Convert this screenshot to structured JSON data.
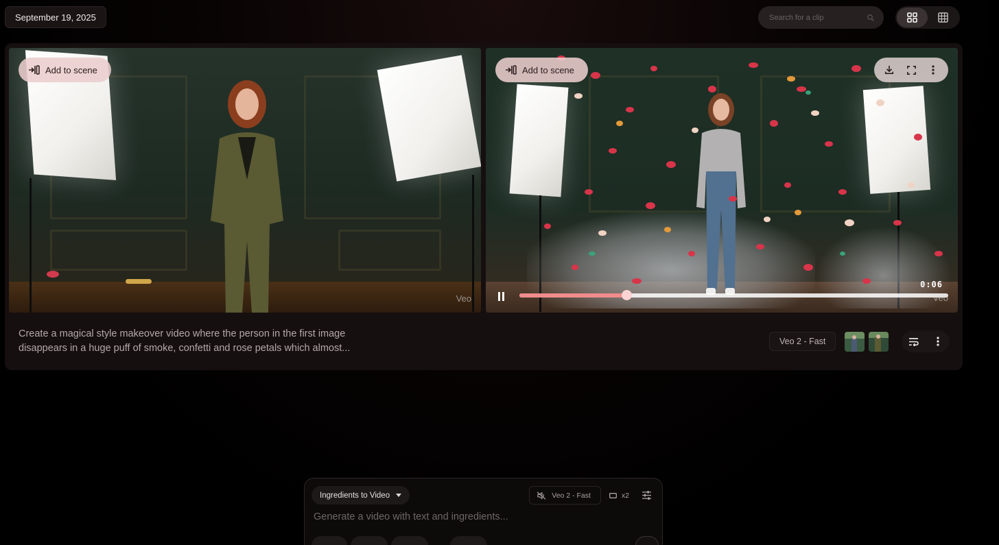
{
  "header": {
    "date": "September 19, 2025",
    "search_placeholder": "Search for a clip",
    "view_toggle": {
      "grid_large_icon": "grid-2x2-icon",
      "grid_small_icon": "grid-3x3-icon",
      "active": "grid_large"
    }
  },
  "clip": {
    "add_to_scene_label": "Add to scene",
    "watermark": "Veo",
    "timecode": "0:06",
    "progress_fraction": 0.25,
    "prompt": "Create a magical style makeover video where the person in the first image disappears in a huge puff of smoke, confetti and rose petals which almost...",
    "model_label": "Veo 2 - Fast",
    "tools": [
      "download-icon",
      "fullscreen-icon",
      "more-vert-icon"
    ]
  },
  "composer": {
    "mode_label": "Ingredients to Video",
    "model_label": "Veo 2 - Fast",
    "count_label": "x2",
    "placeholder": "Generate a video with text and ingredients..."
  },
  "colors": {
    "accent_pink": "#f08c8c",
    "scene_button_bg": "#eacdcd",
    "background": "#000000"
  }
}
